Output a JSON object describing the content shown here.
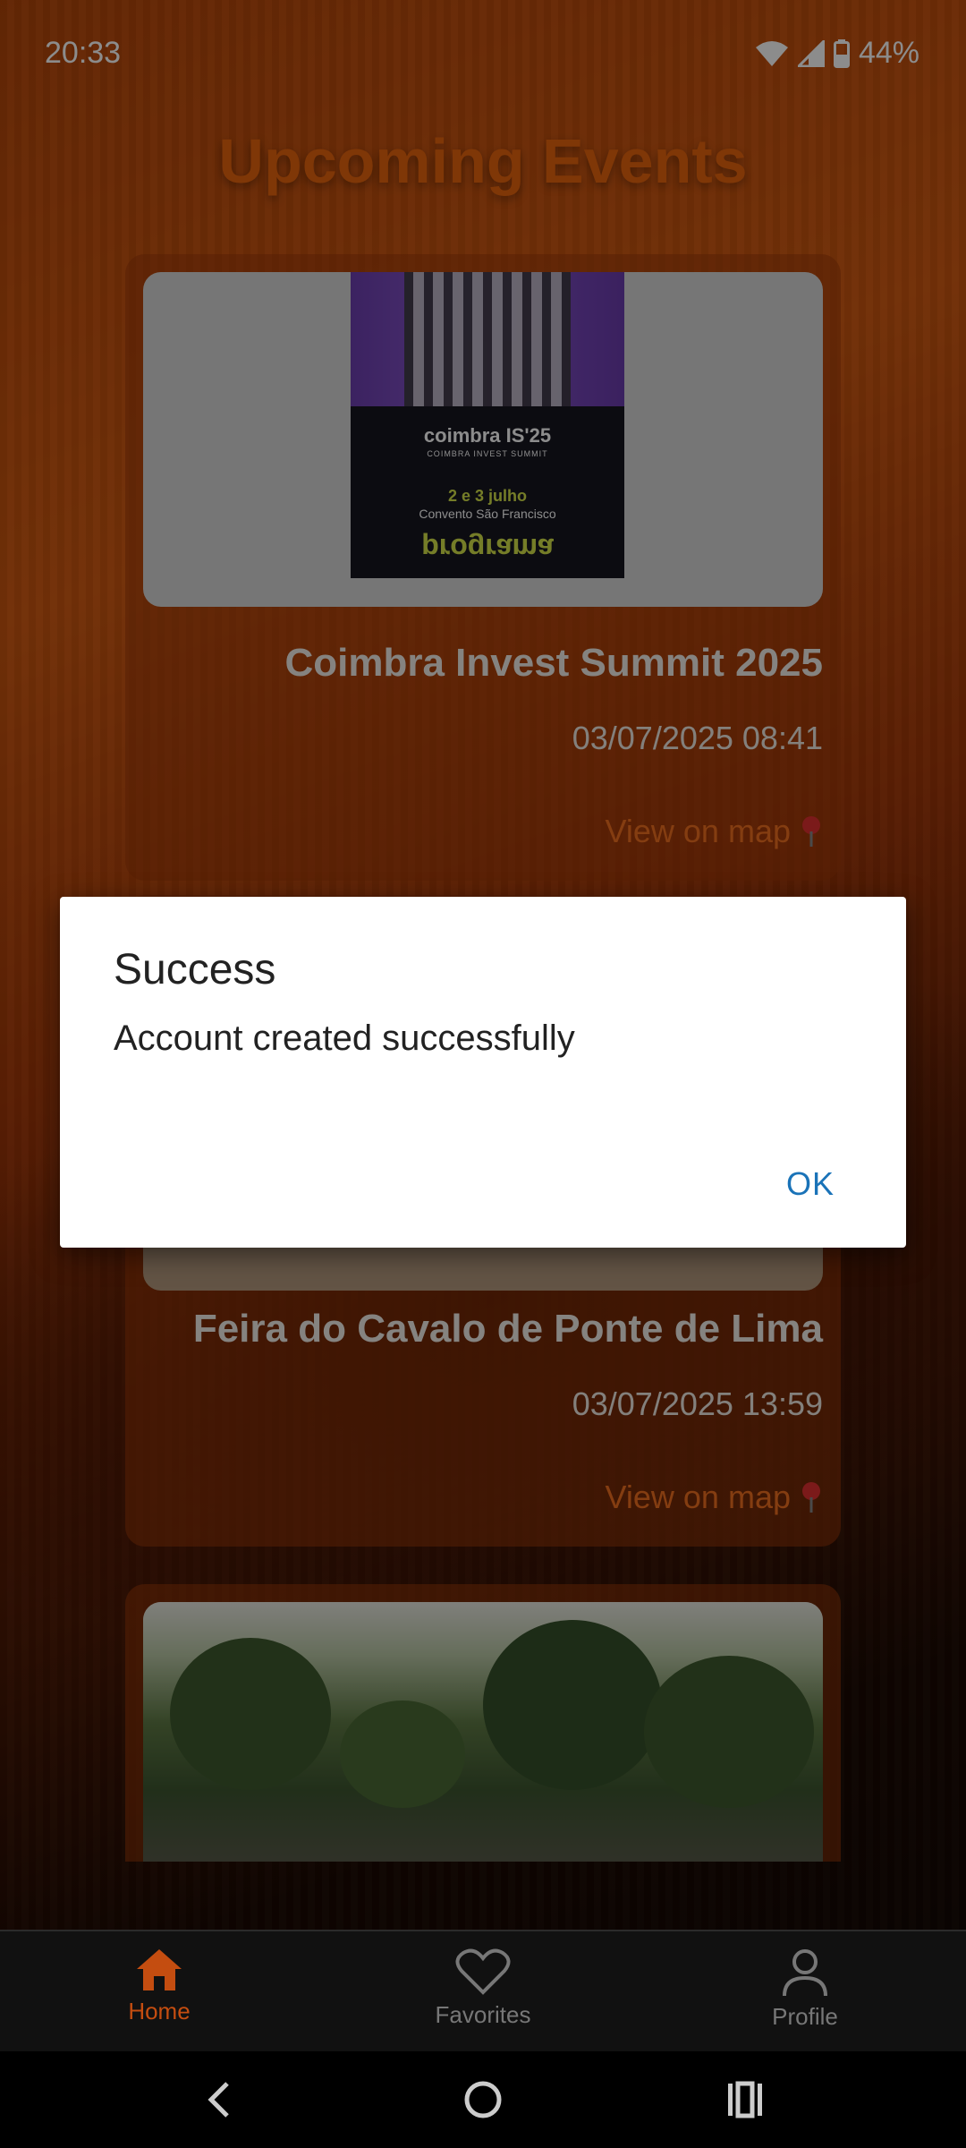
{
  "status_bar": {
    "time": "20:33",
    "battery": "44%"
  },
  "page_title": "Upcoming Events",
  "events": [
    {
      "title": "Coimbra Invest Summit 2025",
      "datetime": "03/07/2025 08:41",
      "map_link": "View on map",
      "poster": {
        "headline": "coimbra IS'25",
        "subline": "COIMBRA INVEST SUMMIT",
        "dates": "2 e 3 julho",
        "venue": "Convento São Francisco",
        "program": "programa"
      }
    },
    {
      "title": "Feira do Cavalo de Ponte de Lima",
      "datetime": "03/07/2025 13:59",
      "map_link": "View on map"
    },
    {
      "title": "",
      "datetime": "",
      "map_link": ""
    }
  ],
  "dialog": {
    "title": "Success",
    "message": "Account created successfully",
    "ok_label": "OK"
  },
  "bottom_nav": {
    "items": [
      {
        "label": "Home",
        "icon": "home-icon",
        "active": true
      },
      {
        "label": "Favorites",
        "icon": "heart-icon",
        "active": false
      },
      {
        "label": "Profile",
        "icon": "person-icon",
        "active": false
      }
    ]
  },
  "colors": {
    "accent": "#e8650e",
    "active_nav": "#c44d10",
    "dialog_button": "#1a73b8"
  }
}
